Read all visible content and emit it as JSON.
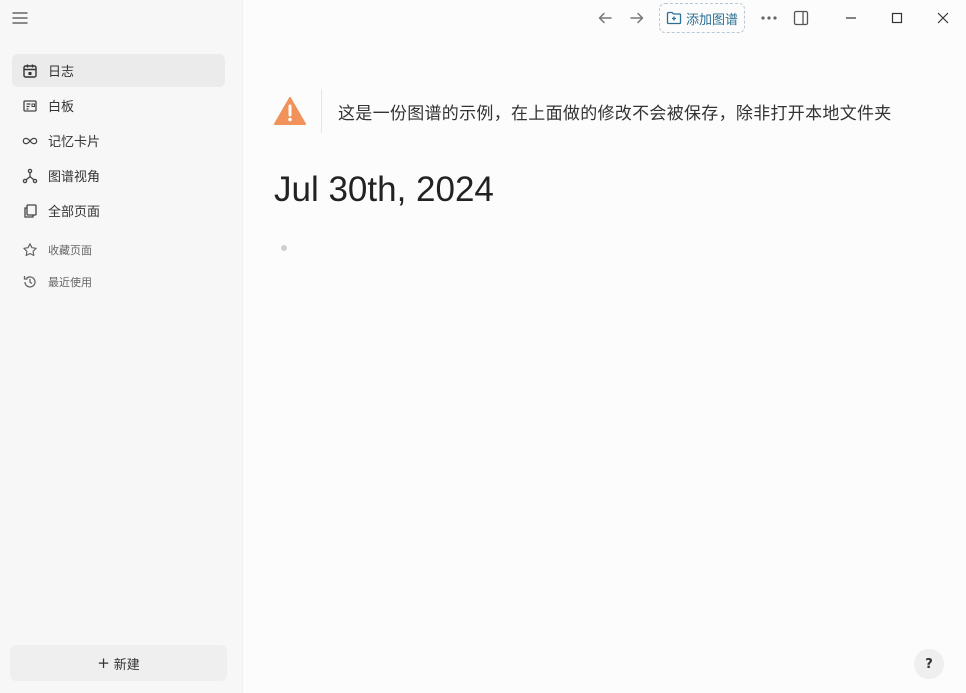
{
  "sidebar": {
    "items": [
      {
        "label": "日志",
        "icon": "calendar-icon",
        "active": true
      },
      {
        "label": "白板",
        "icon": "whiteboard-icon"
      },
      {
        "label": "记忆卡片",
        "icon": "infinity-icon"
      },
      {
        "label": "图谱视角",
        "icon": "graph-icon"
      },
      {
        "label": "全部页面",
        "icon": "pages-icon"
      }
    ],
    "small_items": [
      {
        "label": "收藏页面",
        "icon": "star-icon"
      },
      {
        "label": "最近使用",
        "icon": "history-icon"
      }
    ],
    "new_button": {
      "plus": "+",
      "label": "新建"
    }
  },
  "topbar": {
    "add_graph_label": "添加图谱"
  },
  "main": {
    "warning_text": "这是一份图谱的示例，在上面做的修改不会被保存，除非打开本地文件夹",
    "page_title": "Jul 30th, 2024",
    "help_label": "?"
  },
  "colors": {
    "warning": "#f0925a",
    "accent": "#2a6f94"
  }
}
